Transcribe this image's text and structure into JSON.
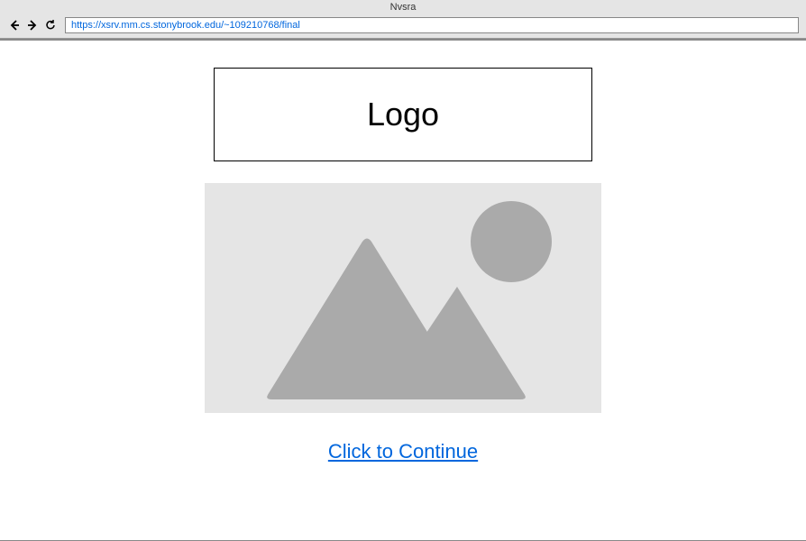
{
  "browser": {
    "title": "Nvsra",
    "url": "https://xsrv.mm.cs.stonybrook.edu/~109210768/final"
  },
  "page": {
    "logo_text": "Logo",
    "continue_link": "Click to Continue"
  }
}
